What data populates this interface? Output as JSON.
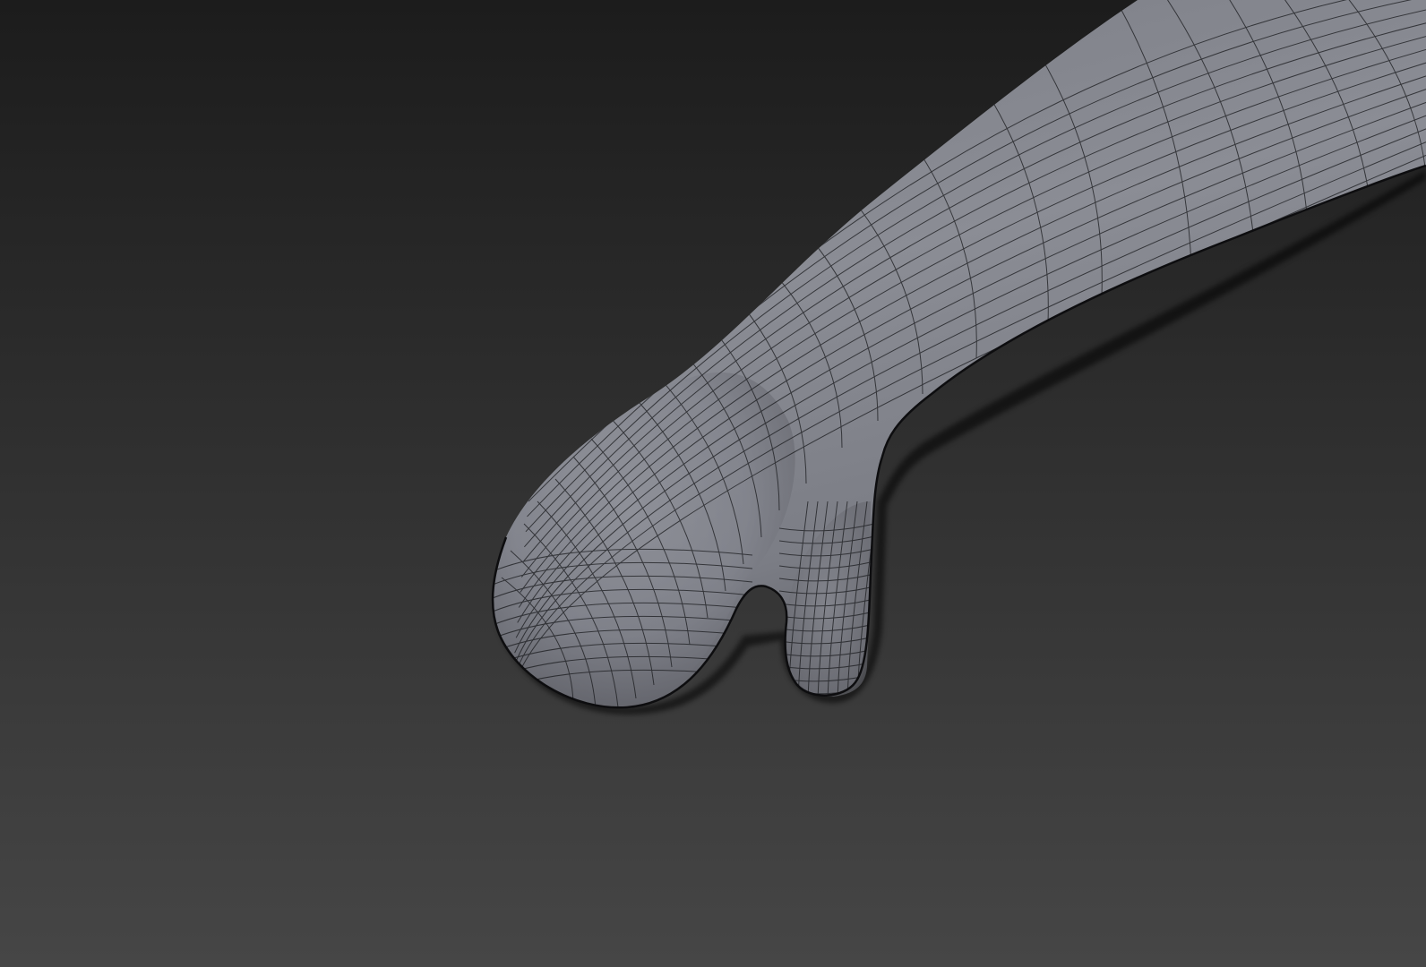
{
  "viewport": {
    "background_top_color": "#1c1c1c",
    "background_bottom_color": "#464646"
  },
  "model": {
    "shading": "gray-clay",
    "wireframe_overlay": true,
    "surface_color": "#8a8c94",
    "highlight_color": "#a3a5ad",
    "shadow_color": "#4a4b50",
    "wire_color": "#1a1b1e"
  }
}
